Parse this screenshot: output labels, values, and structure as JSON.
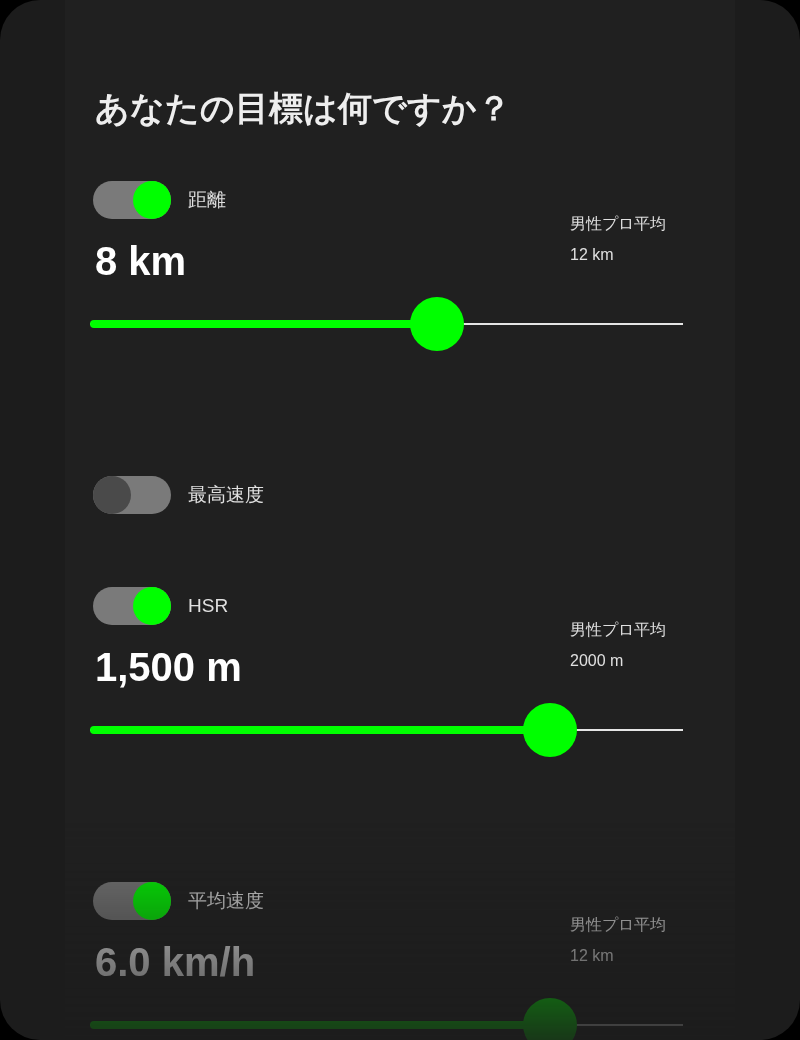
{
  "title": "あなたの目標は何ですか？",
  "goals": [
    {
      "kind": "slider",
      "label": "距離",
      "on": true,
      "value": "8 km",
      "pro_label": "男性プロ平均",
      "pro_value": "12 km",
      "level": 0.585
    },
    {
      "kind": "toggle",
      "label": "最高速度",
      "on": false
    },
    {
      "kind": "slider",
      "label": "HSR",
      "on": true,
      "value": "1,500 m",
      "pro_label": "男性プロ平均",
      "pro_value": "2000 m",
      "level": 0.775
    },
    {
      "kind": "slider",
      "label": "平均速度",
      "on": true,
      "value": "6.0 km/h",
      "pro_label": "男性プロ平均",
      "pro_value": "12 km",
      "level": 0.775
    }
  ]
}
